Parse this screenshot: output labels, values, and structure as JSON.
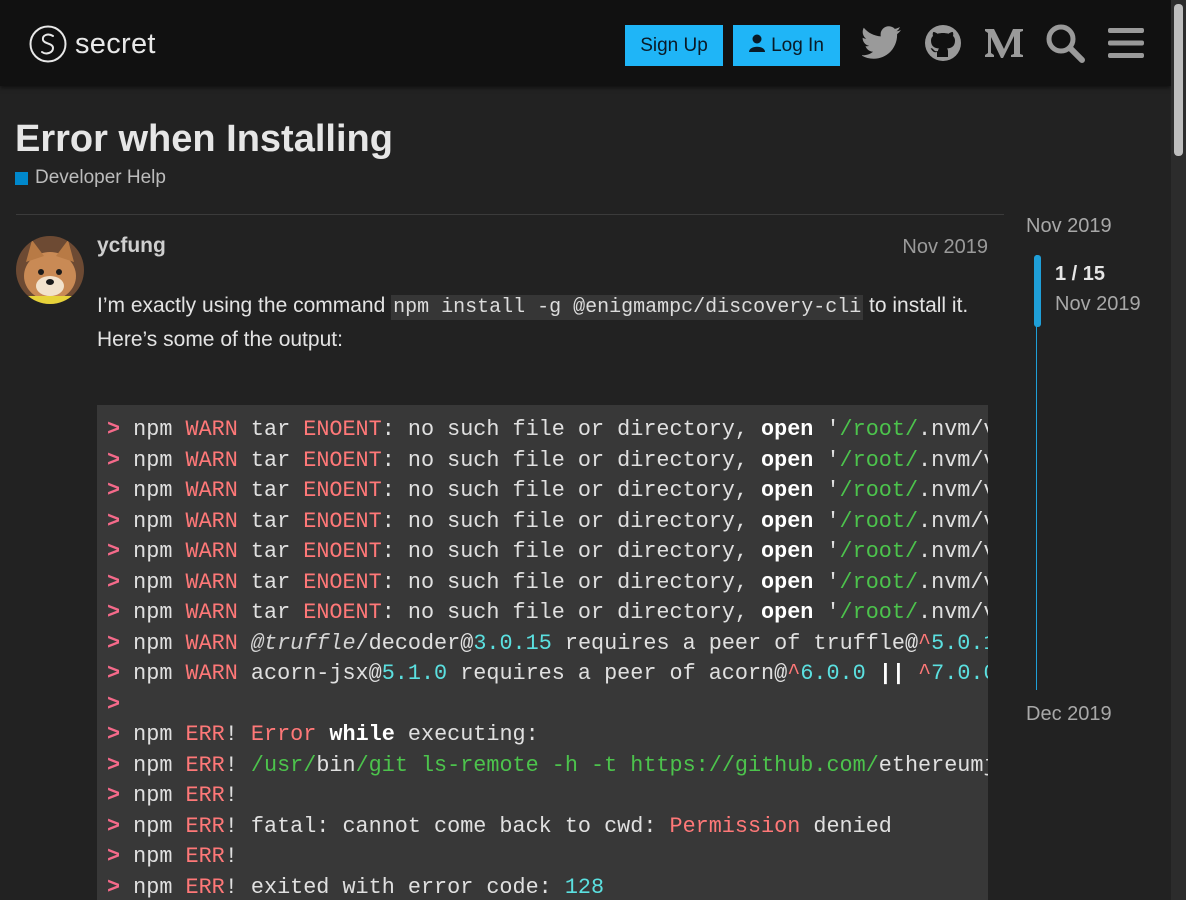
{
  "header": {
    "logo_text": "secret",
    "signup_label": "Sign Up",
    "login_label": "Log In",
    "icons": [
      "twitter-icon",
      "github-icon",
      "medium-icon",
      "search-icon",
      "menu-icon"
    ],
    "accent_color": "#1fb5f7"
  },
  "topic": {
    "title": "Error when Installing",
    "category": "Developer Help",
    "category_color": "#0088cc"
  },
  "post": {
    "username": "ycfung",
    "date": "Nov 2019",
    "text_before_code": "I’m exactly using the command ",
    "inline_code": "npm install -g @enigmampc/discovery-cli",
    "text_after_code": " to install it.",
    "text_line2": "Here’s some of the output:",
    "code_lines": [
      "> npm WARN tar ENOENT: no such file or directory, open '/root/.nvm/v",
      "> npm WARN tar ENOENT: no such file or directory, open '/root/.nvm/v",
      "> npm WARN tar ENOENT: no such file or directory, open '/root/.nvm/v",
      "> npm WARN tar ENOENT: no such file or directory, open '/root/.nvm/v",
      "> npm WARN tar ENOENT: no such file or directory, open '/root/.nvm/v",
      "> npm WARN tar ENOENT: no such file or directory, open '/root/.nvm/v",
      "> npm WARN tar ENOENT: no such file or directory, open '/root/.nvm/v",
      "> npm WARN @truffle/decoder@3.0.15 requires a peer of truffle@^5.0.1",
      "> npm WARN acorn-jsx@5.1.0 requires a peer of acorn@^6.0.0 || ^7.0.0",
      ">",
      "> npm ERR! Error while executing:",
      "> npm ERR! /usr/bin/git ls-remote -h -t https://github.com/ethereumj",
      "> npm ERR!",
      "> npm ERR! fatal: cannot come back to cwd: Permission denied",
      "> npm ERR!",
      "> npm ERR! exited with error code: 128"
    ]
  },
  "timeline": {
    "start_date": "Nov 2019",
    "position": "1 / 15",
    "current_date": "Nov 2019",
    "end_date": "Dec 2019",
    "progress_fraction": 0.0667
  }
}
